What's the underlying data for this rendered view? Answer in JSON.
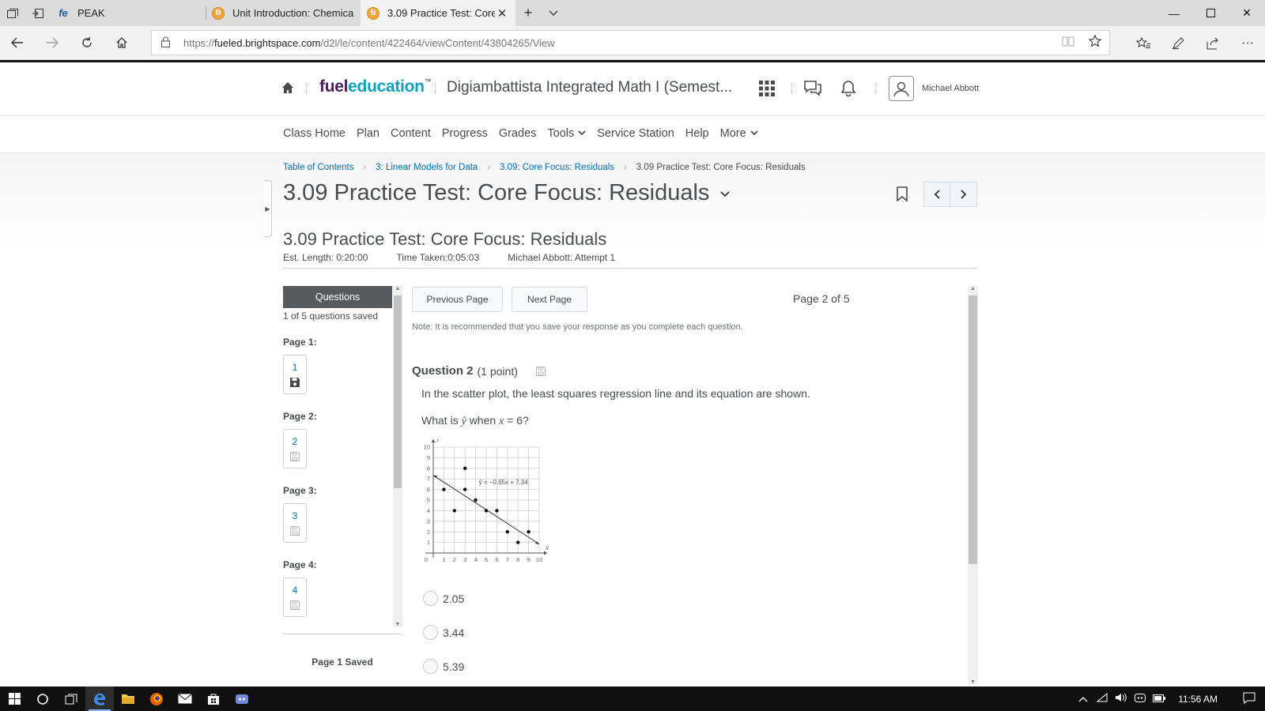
{
  "browser": {
    "tabs": [
      {
        "label": "PEAK",
        "favicon": "fe-icon",
        "active": false
      },
      {
        "label": "Unit Introduction: Chemical",
        "favicon": "brightspace-icon",
        "active": false
      },
      {
        "label": "3.09 Practice Test: Core",
        "favicon": "brightspace-icon",
        "active": true
      }
    ],
    "url_prefix": "https://",
    "url_host": "fueled.brightspace.com",
    "url_path": "/d2l/le/content/422464/viewContent/43804265/View"
  },
  "header": {
    "logo_fuel": "fuel",
    "logo_ed": "ed",
    "logo_rest": "ucation",
    "logo_tm": "™",
    "course_title": "Digiambattista Integrated Math I (Semest...",
    "user_name": "Michael Abbott"
  },
  "nav": {
    "items": [
      "Class Home",
      "Plan",
      "Content",
      "Progress",
      "Grades",
      "Tools",
      "Service Station",
      "Help",
      "More"
    ]
  },
  "breadcrumb": [
    "Table of Contents",
    "3: Linear Models for Data",
    "3.09: Core Focus: Residuals",
    "3.09 Practice Test: Core Focus: Residuals"
  ],
  "page_title": "3.09 Practice Test: Core Focus: Residuals",
  "quiz": {
    "title": "3.09 Practice Test: Core Focus: Residuals",
    "est_length": "Est. Length: 0:20:00",
    "time_taken": "Time Taken:0:05:03",
    "attempt": "Michael Abbott: Attempt 1"
  },
  "questions_panel": {
    "heading": "Questions",
    "saved_count": "1 of 5 questions saved",
    "pages": [
      {
        "label": "Page 1:",
        "question": "1",
        "saved": true
      },
      {
        "label": "Page 2:",
        "question": "2",
        "saved": false
      },
      {
        "label": "Page 3:",
        "question": "3",
        "saved": false
      },
      {
        "label": "Page 4:",
        "question": "4",
        "saved": false
      }
    ],
    "footer": "Page 1 Saved"
  },
  "main": {
    "prev_label": "Previous Page",
    "next_label": "Next Page",
    "page_of": "Page 2 of 5",
    "note": "Note: It is recommended that you save your response as you complete each question.",
    "question_number": "Question 2",
    "points": "(1 point)",
    "question_text": "In the scatter plot, the least squares regression line and its equation are shown.",
    "question_sub_pre": "What is ",
    "question_sub_yhat": "ŷ",
    "question_sub_mid": " when ",
    "question_sub_x": "x",
    "question_sub_post": " = 6?",
    "choices": [
      "2.05",
      "3.44",
      "5.39"
    ]
  },
  "chart_data": {
    "type": "scatter",
    "xlabel": "x",
    "ylabel": "y",
    "xlim": [
      0,
      10
    ],
    "ylim": [
      0,
      10
    ],
    "x_ticks": [
      0,
      1,
      2,
      3,
      4,
      5,
      6,
      7,
      8,
      9,
      10
    ],
    "y_ticks": [
      1,
      2,
      3,
      4,
      5,
      6,
      7,
      8,
      9,
      10
    ],
    "grid": true,
    "points": [
      [
        1,
        6
      ],
      [
        2,
        4
      ],
      [
        3,
        8
      ],
      [
        3,
        6
      ],
      [
        4,
        5
      ],
      [
        5,
        4
      ],
      [
        6,
        4
      ],
      [
        7,
        2
      ],
      [
        8,
        1
      ],
      [
        9,
        2
      ]
    ],
    "regression": {
      "slope": -0.65,
      "intercept": 7.34,
      "x_range": [
        0,
        10
      ],
      "label": "ŷ = −0.65x + 7.34"
    }
  },
  "taskbar": {
    "clock": "11:56 AM"
  },
  "colors": {
    "link": "#006fbf",
    "text": "#494c4e",
    "logo_purple": "#4a1f5e",
    "logo_teal": "#0aa2c0",
    "panel_header": "#565a5c"
  }
}
